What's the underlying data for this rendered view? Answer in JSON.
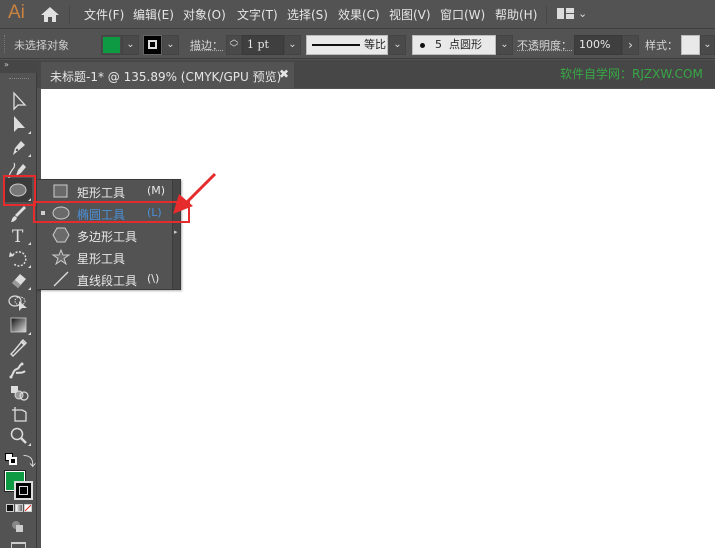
{
  "app": {
    "logo": "Ai"
  },
  "menubar": {
    "items": [
      "文件(F)",
      "编辑(E)",
      "对象(O)",
      "文字(T)",
      "选择(S)",
      "效果(C)",
      "视图(V)",
      "窗口(W)",
      "帮助(H)"
    ],
    "workspace_icon": "workspace-layout-icon"
  },
  "controlbar": {
    "selection_status": "未选择对象",
    "fill_color": "#0e9a43",
    "stroke_label": "描边：",
    "stroke_weight": "1 pt",
    "stroke_profile_label": "等比",
    "brush_label": "5 点圆形",
    "brush_size": "5",
    "brush_name": "点圆形",
    "opacity_label": "不透明度：",
    "opacity_value": "100%",
    "style_label": "样式："
  },
  "document": {
    "tab_title": "未标题-1* @ 135.89% (CMYK/GPU 预览)",
    "close_glyph": "✖",
    "watermark": "软件自学网：RJZXW.COM"
  },
  "toolbar": {
    "collapse_glyph": "»",
    "tools": [
      "selection-tool",
      "direct-selection-tool",
      "pen-tool",
      "curvature-tool",
      "ellipse-tool",
      "paintbrush-tool",
      "type-tool",
      "rotate-tool",
      "eraser-tool",
      "shape-builder-tool",
      "gradient-tool",
      "eyedropper-tool",
      "puppet-warp-tool",
      "live-paint-tool",
      "artboard-tool",
      "zoom-tool"
    ],
    "fill_color": "#0e9a43",
    "stroke_color": "#000000"
  },
  "flyout": {
    "items": [
      {
        "label": "矩形工具",
        "shortcut": "(M)",
        "icon": "rectangle-icon",
        "active": false
      },
      {
        "label": "椭圆工具",
        "shortcut": "(L)",
        "icon": "ellipse-icon",
        "active": true
      },
      {
        "label": "多边形工具",
        "shortcut": "",
        "icon": "polygon-icon",
        "active": false
      },
      {
        "label": "星形工具",
        "shortcut": "",
        "icon": "star-icon",
        "active": false
      },
      {
        "label": "直线段工具",
        "shortcut": "(\\)",
        "icon": "line-segment-icon",
        "active": false
      }
    ]
  },
  "colors": {
    "ui_bg": "#535353",
    "accent_active": "#4a90d9",
    "annotation_red": "#e52b2b",
    "watermark_green": "#37a745"
  }
}
